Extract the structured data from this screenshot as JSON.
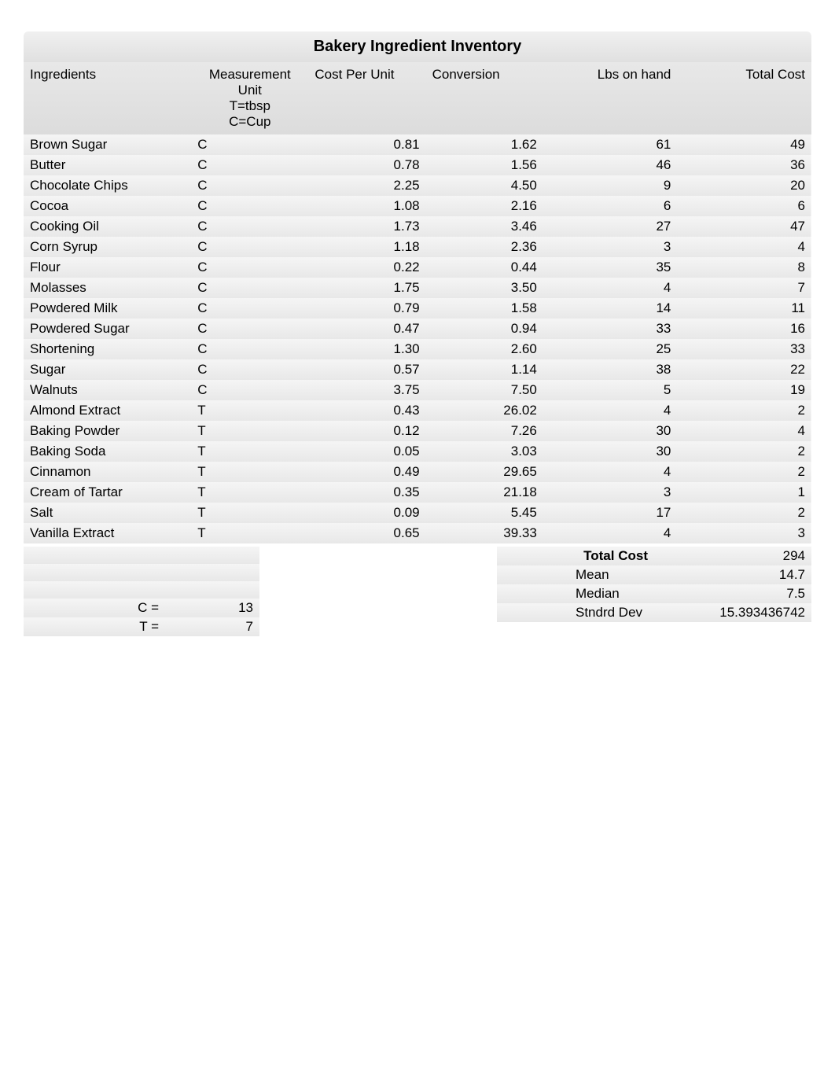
{
  "title": "Bakery Ingredient Inventory",
  "headers": {
    "ingredients": "Ingredients",
    "measurement": "Measurement Unit\nT=tbsp\nC=Cup",
    "measurement_line1": "Measurement",
    "measurement_line2": "Unit",
    "measurement_line3": "T=tbsp",
    "measurement_line4": "C=Cup",
    "cost_per_unit": "Cost Per Unit",
    "conversion": "Conversion",
    "lbs_on_hand": "Lbs on hand",
    "total_cost": "Total Cost"
  },
  "rows": [
    {
      "ingredient": "Brown Sugar",
      "unit": "C",
      "cost": "0.81",
      "conversion": "1.62",
      "lbs": "61",
      "total": "49"
    },
    {
      "ingredient": "Butter",
      "unit": "C",
      "cost": "0.78",
      "conversion": "1.56",
      "lbs": "46",
      "total": "36"
    },
    {
      "ingredient": "Chocolate Chips",
      "unit": "C",
      "cost": "2.25",
      "conversion": "4.50",
      "lbs": "9",
      "total": "20"
    },
    {
      "ingredient": "Cocoa",
      "unit": "C",
      "cost": "1.08",
      "conversion": "2.16",
      "lbs": "6",
      "total": "6"
    },
    {
      "ingredient": "Cooking Oil",
      "unit": "C",
      "cost": "1.73",
      "conversion": "3.46",
      "lbs": "27",
      "total": "47"
    },
    {
      "ingredient": "Corn Syrup",
      "unit": "C",
      "cost": "1.18",
      "conversion": "2.36",
      "lbs": "3",
      "total": "4"
    },
    {
      "ingredient": "Flour",
      "unit": "C",
      "cost": "0.22",
      "conversion": "0.44",
      "lbs": "35",
      "total": "8"
    },
    {
      "ingredient": "Molasses",
      "unit": "C",
      "cost": "1.75",
      "conversion": "3.50",
      "lbs": "4",
      "total": "7"
    },
    {
      "ingredient": "Powdered Milk",
      "unit": "C",
      "cost": "0.79",
      "conversion": "1.58",
      "lbs": "14",
      "total": "11"
    },
    {
      "ingredient": "Powdered Sugar",
      "unit": "C",
      "cost": "0.47",
      "conversion": "0.94",
      "lbs": "33",
      "total": "16"
    },
    {
      "ingredient": "Shortening",
      "unit": "C",
      "cost": "1.30",
      "conversion": "2.60",
      "lbs": "25",
      "total": "33"
    },
    {
      "ingredient": "Sugar",
      "unit": "C",
      "cost": "0.57",
      "conversion": "1.14",
      "lbs": "38",
      "total": "22"
    },
    {
      "ingredient": "Walnuts",
      "unit": "C",
      "cost": "3.75",
      "conversion": "7.50",
      "lbs": "5",
      "total": "19"
    },
    {
      "ingredient": "Almond Extract",
      "unit": "T",
      "cost": "0.43",
      "conversion": "26.02",
      "lbs": "4",
      "total": "2"
    },
    {
      "ingredient": "Baking Powder",
      "unit": "T",
      "cost": "0.12",
      "conversion": "7.26",
      "lbs": "30",
      "total": "4"
    },
    {
      "ingredient": "Baking Soda",
      "unit": "T",
      "cost": "0.05",
      "conversion": "3.03",
      "lbs": "30",
      "total": "2"
    },
    {
      "ingredient": "Cinnamon",
      "unit": "T",
      "cost": "0.49",
      "conversion": "29.65",
      "lbs": "4",
      "total": "2"
    },
    {
      "ingredient": "Cream of Tartar",
      "unit": "T",
      "cost": "0.35",
      "conversion": "21.18",
      "lbs": "3",
      "total": "1"
    },
    {
      "ingredient": "Salt",
      "unit": "T",
      "cost": "0.09",
      "conversion": "5.45",
      "lbs": "17",
      "total": "2"
    },
    {
      "ingredient": "Vanilla Extract",
      "unit": "T",
      "cost": "0.65",
      "conversion": "39.33",
      "lbs": "4",
      "total": "3"
    }
  ],
  "summary": {
    "total_cost_label": "Total Cost",
    "total_cost_value": "294",
    "mean_label": "Mean",
    "mean_value": "14.7",
    "median_label": "Median",
    "median_value": "7.5",
    "stndrd_dev_label": "Stndrd Dev",
    "stndrd_dev_value": "15.393436742"
  },
  "legend": {
    "c_label": "C =",
    "c_value": "13",
    "t_label": "T =",
    "t_value": "7"
  }
}
